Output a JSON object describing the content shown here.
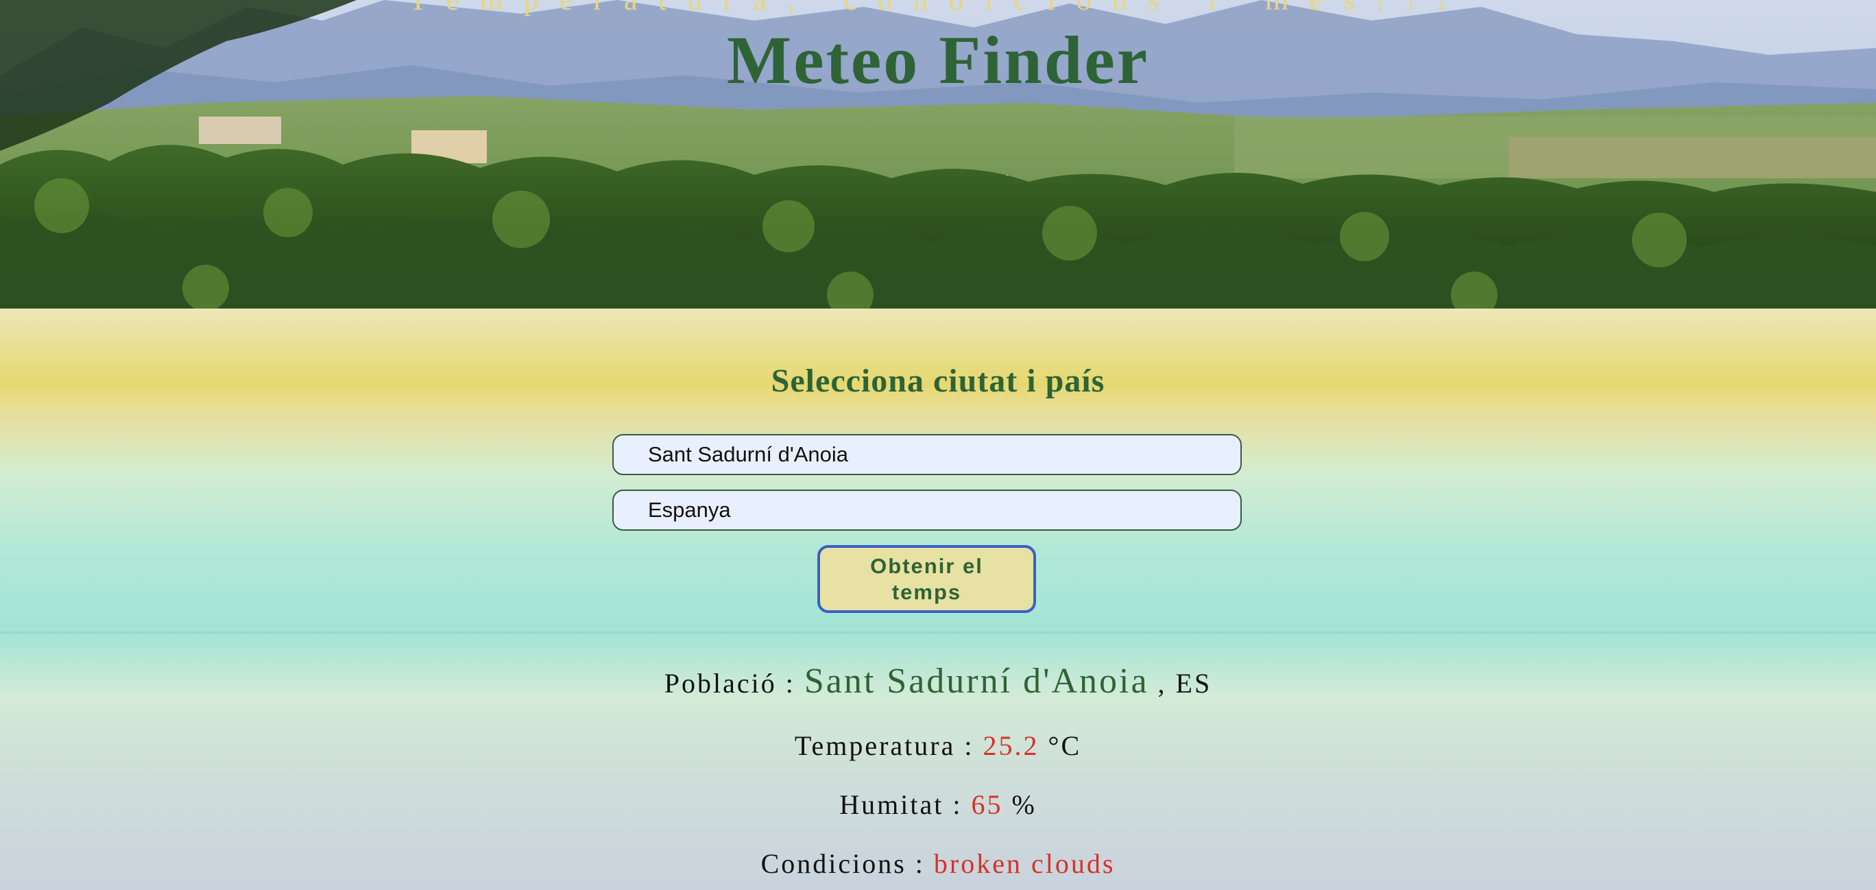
{
  "header": {
    "tagline": "Temperatura, condicions i més!!!",
    "title": "Meteo Finder"
  },
  "form": {
    "heading": "Selecciona ciutat i país",
    "city_value": "Sant Sadurní d'Anoia",
    "country_value": "Espanya",
    "submit_label": "Obtenir el temps"
  },
  "results": {
    "city_label": "Població :",
    "city_value": "Sant Sadurní d'Anoia",
    "country_code": ", ES",
    "temperature_label": "Temperatura :",
    "temperature_value": "25.2",
    "temperature_unit": "°C",
    "humidity_label": "Humitat :",
    "humidity_value": "65",
    "humidity_unit": "%",
    "conditions_label": "Condicions :",
    "conditions_value": "broken clouds"
  },
  "colors": {
    "title_green": "#2e6336",
    "value_red": "#d9302a",
    "tagline_yellow": "#e8d67a",
    "button_fill": "#e8e1a4",
    "button_border": "#3a5fc8",
    "input_fill": "#e8effd"
  }
}
